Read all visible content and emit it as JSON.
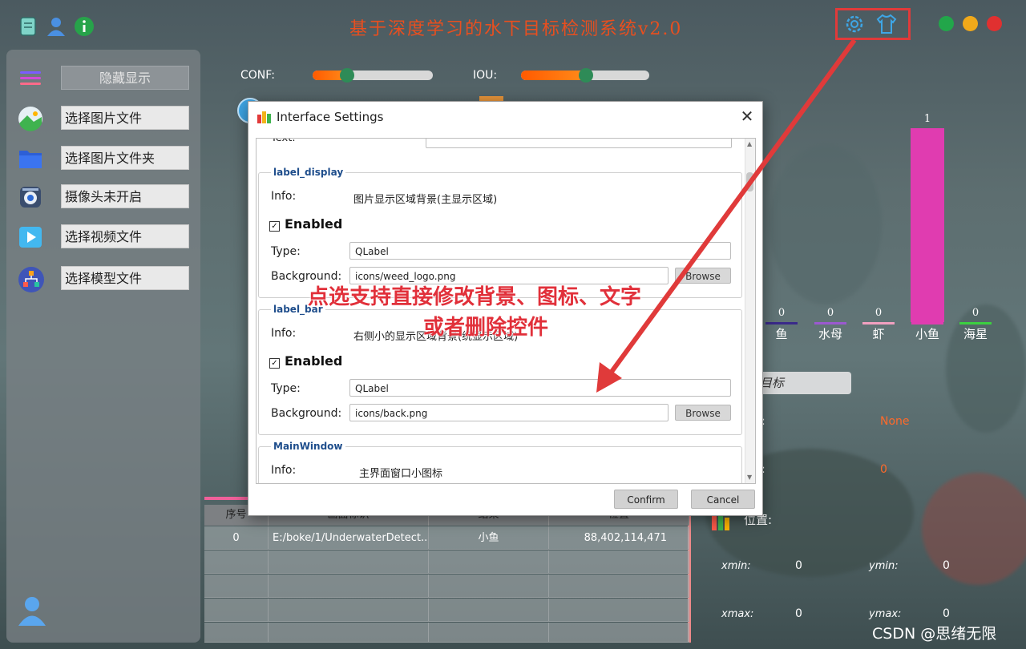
{
  "app": {
    "title": "基于深度学习的水下目标检测系统v2.0"
  },
  "colors": {
    "title": "#e84f1f",
    "highlight": "#e03a3a",
    "bar_pink": "#e03cb0",
    "orange": "#ff5a00"
  },
  "toolbar": {
    "icons": [
      "notebook-icon",
      "user-icon",
      "info-icon"
    ],
    "right_icons": [
      "settings-gear-icon",
      "theme-shirt-icon"
    ]
  },
  "window_controls": [
    "maximize-green-dot",
    "minimize-yellow-dot",
    "close-red-dot"
  ],
  "sidebar": {
    "items": [
      {
        "icon": "menu-lines-icon",
        "label": "隐藏显示"
      },
      {
        "icon": "landscape-image-icon",
        "label": "选择图片文件"
      },
      {
        "icon": "folder-icon",
        "label": "选择图片文件夹"
      },
      {
        "icon": "camera-icon",
        "label": "摄像头未开启"
      },
      {
        "icon": "video-play-icon",
        "label": "选择视频文件"
      },
      {
        "icon": "model-hierarchy-icon",
        "label": "选择模型文件"
      }
    ]
  },
  "params": {
    "conf_label": "CONF:",
    "conf_value": 0.25,
    "iou_label": "IOU:",
    "iou_value": 0.5
  },
  "chart_data": {
    "type": "bar",
    "categories": [
      "鱼",
      "水母",
      "虾",
      "小鱼",
      "海星"
    ],
    "values": [
      0,
      0,
      0,
      1,
      0
    ],
    "category_colors": [
      "#3a2a8a",
      "#9b59d0",
      "#f2a0c0",
      "#e03cb0",
      "#3cd040"
    ],
    "ylim": [
      0,
      1
    ]
  },
  "chart_labels": {
    "values": [
      "0",
      "0",
      "0",
      "1",
      "0"
    ]
  },
  "right_panel": {
    "target_button": "目标",
    "class_value": "None",
    "conf_value": "0",
    "position_label": "位置:",
    "xmin_label": "xmin:",
    "xmin_value": "0",
    "ymin_label": "ymin:",
    "ymin_value": "0",
    "xmax_label": "xmax:",
    "xmax_value": "0",
    "ymax_label": "ymax:",
    "ymax_value": "0"
  },
  "table": {
    "headers": [
      "序号",
      "画面标识",
      "结果",
      "位置"
    ],
    "rows": [
      [
        "0",
        "E:/boke/1/UnderwaterDetect...",
        "小鱼",
        "88,402,114,471"
      ]
    ]
  },
  "dialog": {
    "title": "Interface Settings",
    "top_field_label": "Text:",
    "groups": [
      {
        "name": "label_display",
        "info_label": "Info:",
        "info": "图片显示区域背景(主显示区域)",
        "enabled_label": "Enabled",
        "type_label": "Type:",
        "type": "QLabel",
        "bg_label": "Background:",
        "background": "icons/weed_logo.png",
        "browse": "Browse"
      },
      {
        "name": "label_bar",
        "info_label": "Info:",
        "info": "右侧小的显示区域背景(统显示区域)",
        "enabled_label": "Enabled",
        "type_label": "Type:",
        "type": "QLabel",
        "bg_label": "Background:",
        "background": "icons/back.png",
        "browse": "Browse"
      },
      {
        "name": "MainWindow",
        "info_label": "Info:",
        "info": "主界面窗口小图标"
      }
    ],
    "confirm": "Confirm",
    "cancel": "Cancel"
  },
  "annotation": {
    "line1": "点选支持直接修改背景、图标、文字",
    "line2": "或者删除控件"
  },
  "watermark": "CSDN @思绪无限"
}
